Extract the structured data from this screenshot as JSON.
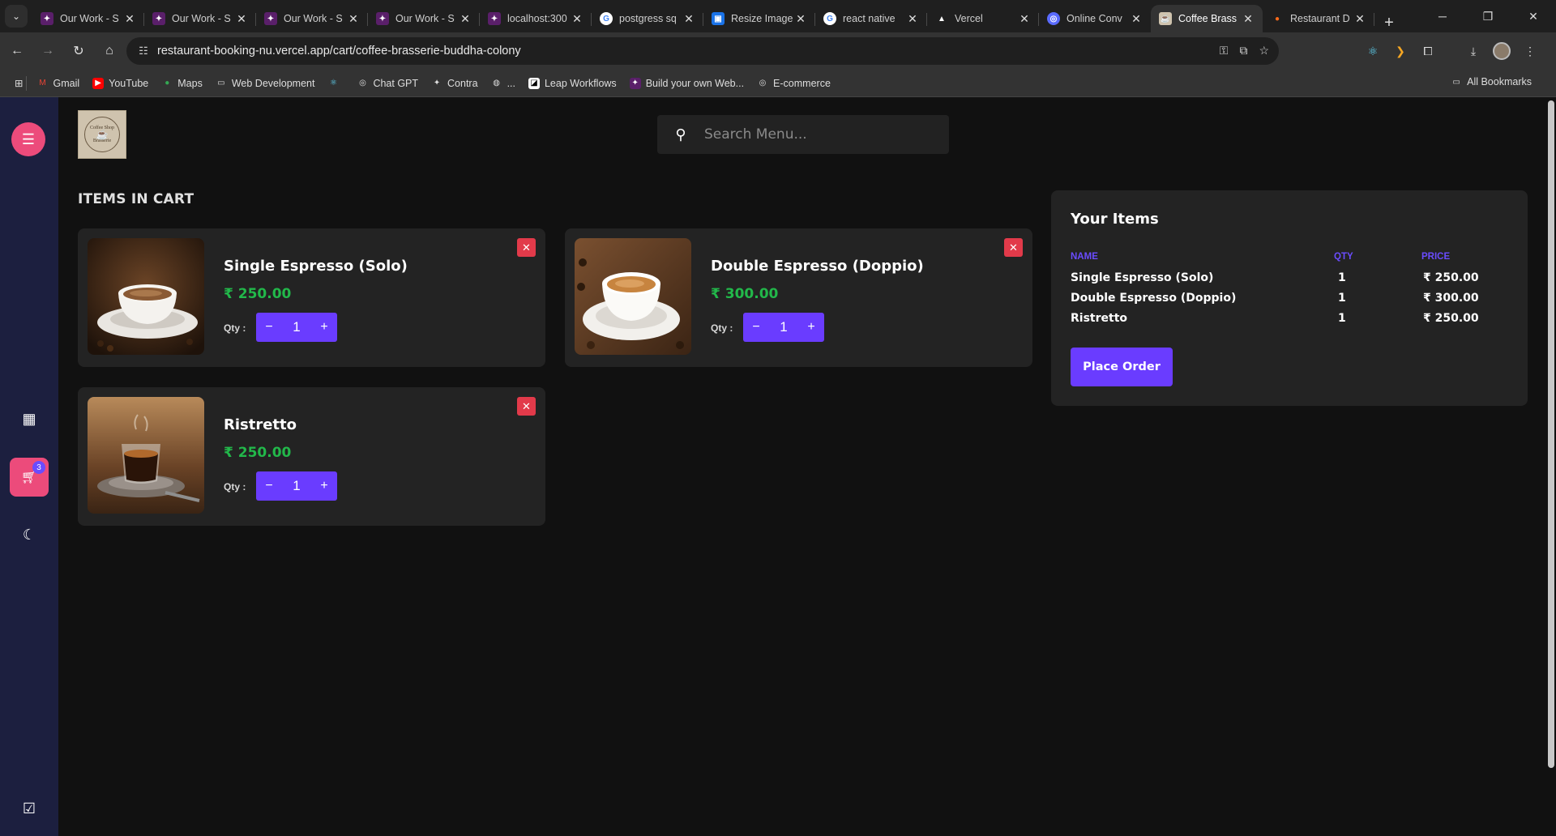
{
  "browser": {
    "tabs": [
      {
        "title": "Our Work - S",
        "icon_color": "#5a1f6a"
      },
      {
        "title": "Our Work - S",
        "icon_color": "#5a1f6a"
      },
      {
        "title": "Our Work - S",
        "icon_color": "#5a1f6a"
      },
      {
        "title": "Our Work - S",
        "icon_color": "#5a1f6a"
      },
      {
        "title": "localhost:300",
        "icon_color": "#5a1f6a"
      },
      {
        "title": "postgress sq",
        "icon_color": "#ffffff"
      },
      {
        "title": "Resize Image",
        "icon_color": "#1a73e8"
      },
      {
        "title": "react native",
        "icon_color": "#ffffff"
      },
      {
        "title": "Vercel",
        "icon_color": "#000000"
      },
      {
        "title": "Online Conv",
        "icon_color": "#5a6bff"
      },
      {
        "title": "Coffee Brass",
        "icon_color": "#cfc3ae"
      },
      {
        "title": "Restaurant D",
        "icon_color": "#ff6a1a"
      }
    ],
    "url": "restaurant-booking-nu.vercel.app/cart/coffee-brasserie-buddha-colony",
    "bookmarks": [
      "Gmail",
      "YouTube",
      "Maps",
      "Web Development",
      "Chat GPT",
      "Contra",
      "...",
      "Leap Workflows",
      "Build your own Web...",
      "E-commerce"
    ],
    "all_bookmarks": "All Bookmarks"
  },
  "app": {
    "logo": {
      "line1": "Coffee Shop",
      "line2": "Brasserie"
    },
    "search": {
      "placeholder": "Search Menu..."
    },
    "section_title": "ITEMS IN CART",
    "cart_badge": "3",
    "items": [
      {
        "name": "Single Espresso (Solo)",
        "price": "₹ 250.00",
        "qty_label": "Qty :",
        "qty": "1"
      },
      {
        "name": "Double Espresso (Doppio)",
        "price": "₹ 300.00",
        "qty_label": "Qty :",
        "qty": "1"
      },
      {
        "name": "Ristretto",
        "price": "₹ 250.00",
        "qty_label": "Qty :",
        "qty": "1"
      }
    ],
    "summary": {
      "title": "Your Items",
      "headers": {
        "name": "NAME",
        "qty": "QTY",
        "price": "PRICE"
      },
      "rows": [
        {
          "name": "Single Espresso (Solo)",
          "qty": "1",
          "price": "₹ 250.00"
        },
        {
          "name": "Double Espresso (Doppio)",
          "qty": "1",
          "price": "₹ 300.00"
        },
        {
          "name": "Ristretto",
          "qty": "1",
          "price": "₹ 250.00"
        }
      ],
      "button": "Place Order"
    },
    "colors": {
      "accent": "#6a3cff",
      "pink": "#ec4b7b",
      "price_green": "#22b84a",
      "remove_red": "#e23a4a",
      "sidebar": "#1c1f3f"
    }
  }
}
